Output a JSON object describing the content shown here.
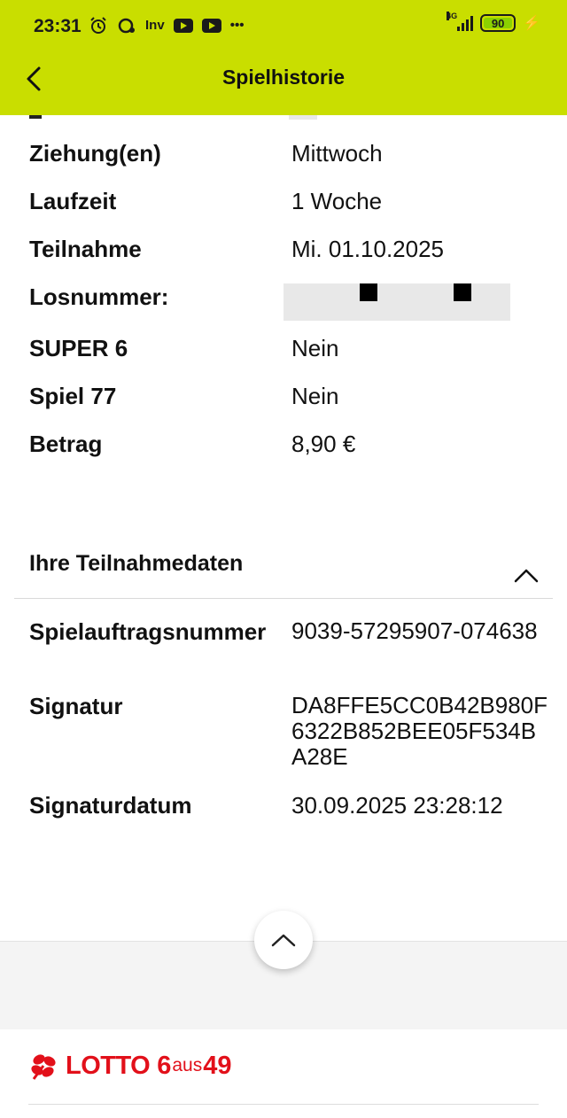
{
  "status_bar": {
    "time": "23:31",
    "network": "4G",
    "battery": "90",
    "notification_icons": [
      "alarm-icon",
      "chat-icon",
      "inv-icon",
      "youtube-icon",
      "youtube-icon",
      "more-dots-icon"
    ],
    "inv_label": "Inv"
  },
  "header": {
    "title": "Spielhistorie",
    "background": "#c9de00"
  },
  "details": [
    {
      "label": "Ziehung(en)",
      "value": "Mittwoch"
    },
    {
      "label": "Laufzeit",
      "value": "1 Woche"
    },
    {
      "label": "Teilnahme",
      "value": "Mi. 01.10.2025"
    },
    {
      "label": "Losnummer:",
      "value": ""
    },
    {
      "label": "SUPER 6",
      "value": "Nein"
    },
    {
      "label": "Spiel 77",
      "value": "Nein"
    },
    {
      "label": "Betrag",
      "value": "8,90 €"
    }
  ],
  "participation_section": {
    "title": "Ihre Teilnahmedaten",
    "rows": [
      {
        "label": "Spielauftragsnummer",
        "value": "9039-57295907-074638"
      },
      {
        "label": "Signatur",
        "value": "DA8FFE5CC0B42B980F6322B852BEE05F534BA28E"
      },
      {
        "label": "Signaturdatum",
        "value": "30.09.2025 23:28:12"
      }
    ]
  },
  "footer": {
    "logo": {
      "word": "LOTTO",
      "six": "6",
      "aus": "aus",
      "fortynine": "49"
    },
    "brand_color": "#e2101a"
  }
}
